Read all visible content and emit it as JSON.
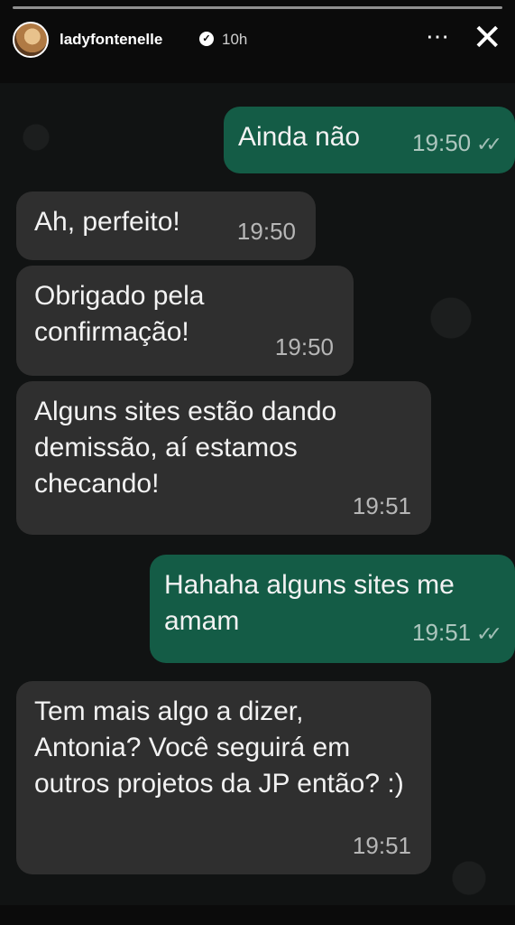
{
  "story": {
    "username": "ladyfontenelle",
    "time_ago": "10h",
    "more_icon": "⋯",
    "close_icon": "✕"
  },
  "messages": [
    {
      "direction": "out",
      "text": "Ainda não",
      "time": "19:50",
      "ticks": "✓✓"
    },
    {
      "direction": "in",
      "text": "Ah, perfeito!",
      "time": "19:50"
    },
    {
      "direction": "in",
      "text": "Obrigado pela confirmação!",
      "time": "19:50"
    },
    {
      "direction": "in",
      "text": "Alguns sites estão dando demissão, aí estamos checando!",
      "time": "19:51"
    },
    {
      "direction": "out",
      "text": "Hahaha alguns sites me amam",
      "time": "19:51",
      "ticks": "✓✓"
    },
    {
      "direction": "in",
      "text": "Tem mais algo a dizer, Antonia? Você seguirá em outros projetos da JP então? :)",
      "time": "19:51"
    }
  ],
  "colors": {
    "outgoing_bubble": "#145c46",
    "incoming_bubble": "#2f2f2f",
    "chat_background": "#111313"
  }
}
